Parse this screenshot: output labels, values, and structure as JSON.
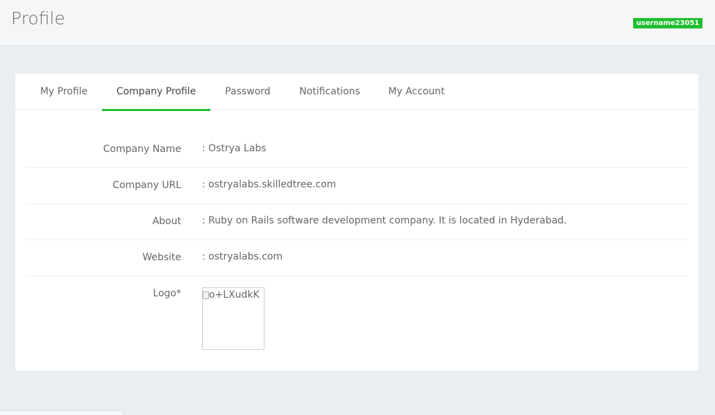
{
  "header": {
    "title": "Profile",
    "username": "username23051",
    "badge_color": "#1ebf2e"
  },
  "tabs": [
    {
      "label": "My Profile",
      "active": false
    },
    {
      "label": "Company Profile",
      "active": true
    },
    {
      "label": "Password",
      "active": false
    },
    {
      "label": "Notifications",
      "active": false
    },
    {
      "label": "My Account",
      "active": false
    }
  ],
  "company": {
    "fields": [
      {
        "label": "Company Name",
        "value": ": Ostrya Labs"
      },
      {
        "label": "Company URL",
        "value": ": ostryalabs.skilledtree.com"
      },
      {
        "label": "About",
        "value": ": Ruby on Rails software development company. It is located in Hyderabad."
      },
      {
        "label": "Website",
        "value": ": ostryalabs.com"
      }
    ],
    "logo": {
      "label": "Logo*",
      "alt_text": "o+LXudkK",
      "icon": "broken-image-icon"
    }
  }
}
